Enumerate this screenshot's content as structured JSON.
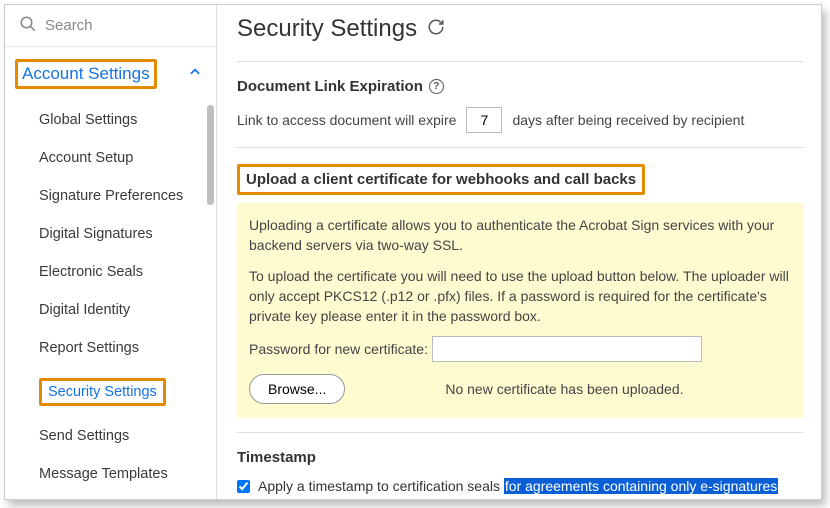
{
  "search": {
    "placeholder": "Search"
  },
  "sidebar": {
    "header": "Account Settings",
    "items": [
      {
        "label": "Global Settings"
      },
      {
        "label": "Account Setup"
      },
      {
        "label": "Signature Preferences"
      },
      {
        "label": "Digital Signatures"
      },
      {
        "label": "Electronic Seals"
      },
      {
        "label": "Digital Identity"
      },
      {
        "label": "Report Settings"
      },
      {
        "label": "Security Settings"
      },
      {
        "label": "Send Settings"
      },
      {
        "label": "Message Templates"
      }
    ]
  },
  "page": {
    "title": "Security Settings"
  },
  "linkExp": {
    "title": "Document Link Expiration",
    "prefix": "Link to access document will expire",
    "value": "7",
    "suffix": "days after being received by recipient"
  },
  "cert": {
    "title": "Upload a client certificate for webhooks and call backs",
    "p1": "Uploading a certificate allows you to authenticate the Acrobat Sign services with your backend servers via two-way SSL.",
    "p2": "To upload the certificate you will need to use the upload button below. The uploader will only accept PKCS12 (.p12 or .pfx) files. If a password is required for the certificate's private key please enter it in the password box.",
    "pwdLabel": "Password for new certificate:",
    "browse": "Browse...",
    "status": "No new certificate has been uploaded."
  },
  "timestamp": {
    "title": "Timestamp",
    "label": "Apply a timestamp to certification seals ",
    "highlight": "for agreements containing only e-signatures",
    "checked": true
  }
}
